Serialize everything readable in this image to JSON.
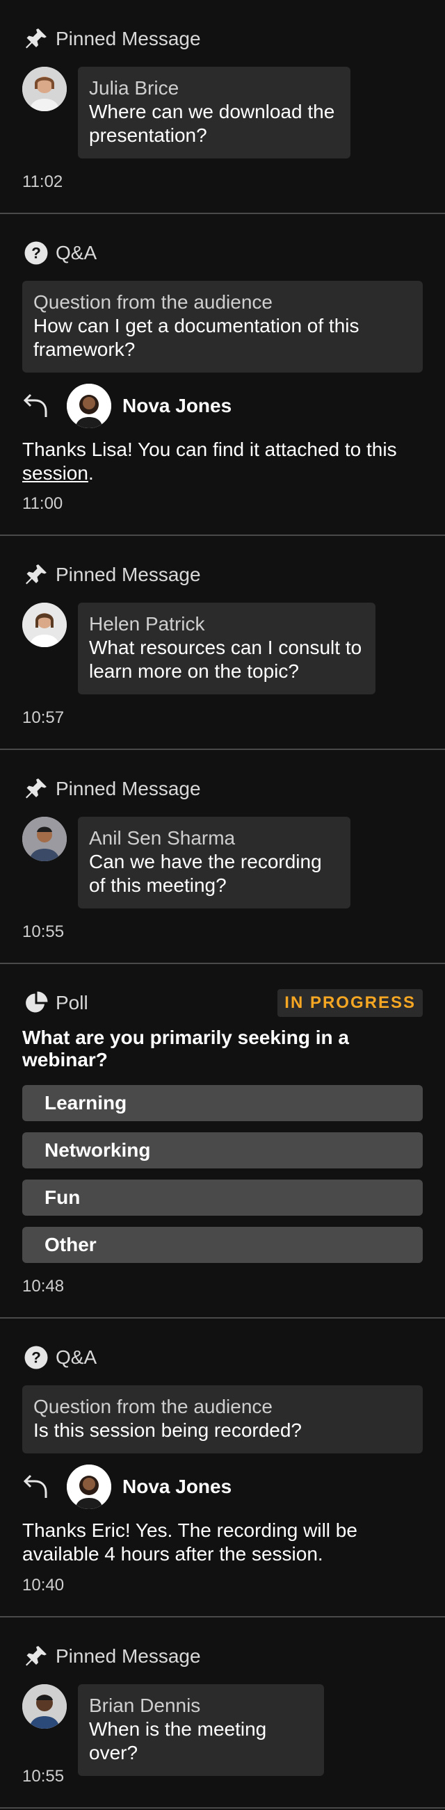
{
  "cards": [
    {
      "type": "pinned",
      "title": "Pinned Message",
      "name": "Julia Brice",
      "message": "Where can we download the presentation?",
      "time": "11:02"
    },
    {
      "type": "qa",
      "title": "Q&A",
      "q_label": "Question from the audience",
      "question": "How can I get a documentation of this framework?",
      "responder": "Nova Jones",
      "answer_main": "Thanks Lisa! You can find it attached to this ",
      "answer_link": "session",
      "answer_end": ".",
      "time": "11:00"
    },
    {
      "type": "pinned",
      "title": "Pinned Message",
      "name": "Helen Patrick",
      "message": "What resources can I consult to learn more on the topic?",
      "time": "10:57"
    },
    {
      "type": "pinned",
      "title": "Pinned Message",
      "name": "Anil Sen Sharma",
      "message": "Can we have the recording of this meeting?",
      "time": "10:55"
    },
    {
      "type": "poll",
      "title": "Poll",
      "status": "IN PROGRESS",
      "question": "What are you primarily seeking in a webinar?",
      "options": [
        "Learning",
        "Networking",
        "Fun",
        "Other"
      ],
      "time": "10:48"
    },
    {
      "type": "qa",
      "title": "Q&A",
      "q_label": "Question from the audience",
      "question": "Is this session being recorded?",
      "responder": "Nova Jones",
      "answer_main": "Thanks Eric! Yes. The recording will be available 4 hours after the session.",
      "answer_link": "",
      "answer_end": "",
      "time": "10:40"
    },
    {
      "type": "pinned",
      "title": "Pinned Message",
      "name": "Brian Dennis",
      "message": "When is the meeting over?",
      "time": "10:55"
    }
  ],
  "colors": {
    "badge": "#f5a623",
    "bubble": "#2b2b2b",
    "option": "#4a4a4a"
  }
}
